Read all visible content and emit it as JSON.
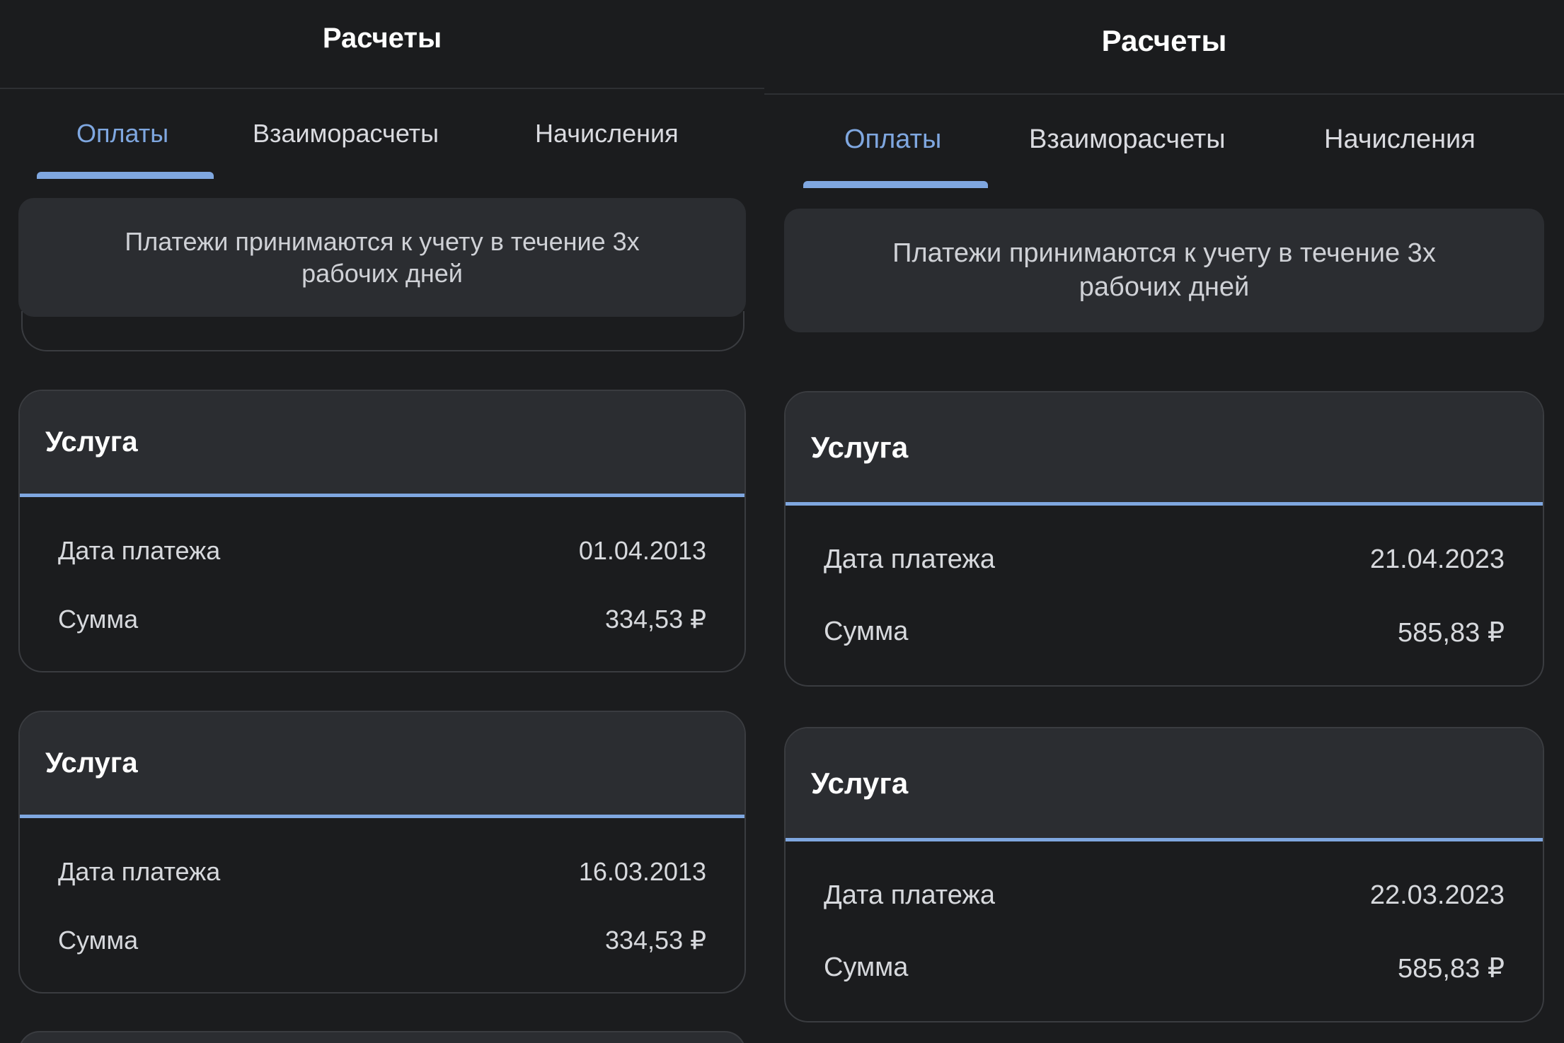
{
  "screens": [
    {
      "title": "Расчеты",
      "tabs": [
        "Оплаты",
        "Взаиморасчеты",
        "Начисления"
      ],
      "active_tab": 0,
      "notice": "Платежи принимаются к учету в течение 3х рабочих дней",
      "cards": [
        {
          "title": "Услуга",
          "date_label": "Дата платежа",
          "date": "01.04.2013",
          "sum_label": "Сумма",
          "sum": "334,53 ₽"
        },
        {
          "title": "Услуга",
          "date_label": "Дата платежа",
          "date": "16.03.2013",
          "sum_label": "Сумма",
          "sum": "334,53 ₽"
        }
      ]
    },
    {
      "title": "Расчеты",
      "tabs": [
        "Оплаты",
        "Взаиморасчеты",
        "Начисления"
      ],
      "active_tab": 0,
      "notice": "Платежи принимаются к учету в течение 3х рабочих дней",
      "cards": [
        {
          "title": "Услуга",
          "date_label": "Дата платежа",
          "date": "21.04.2023",
          "sum_label": "Сумма",
          "sum": "585,83 ₽"
        },
        {
          "title": "Услуга",
          "date_label": "Дата платежа",
          "date": "22.03.2023",
          "sum_label": "Сумма",
          "sum": "585,83 ₽"
        }
      ]
    }
  ],
  "colors": {
    "background": "#1b1c1e",
    "surface": "#2b2d31",
    "accent": "#7fa7e0",
    "border": "#3a3c40"
  }
}
